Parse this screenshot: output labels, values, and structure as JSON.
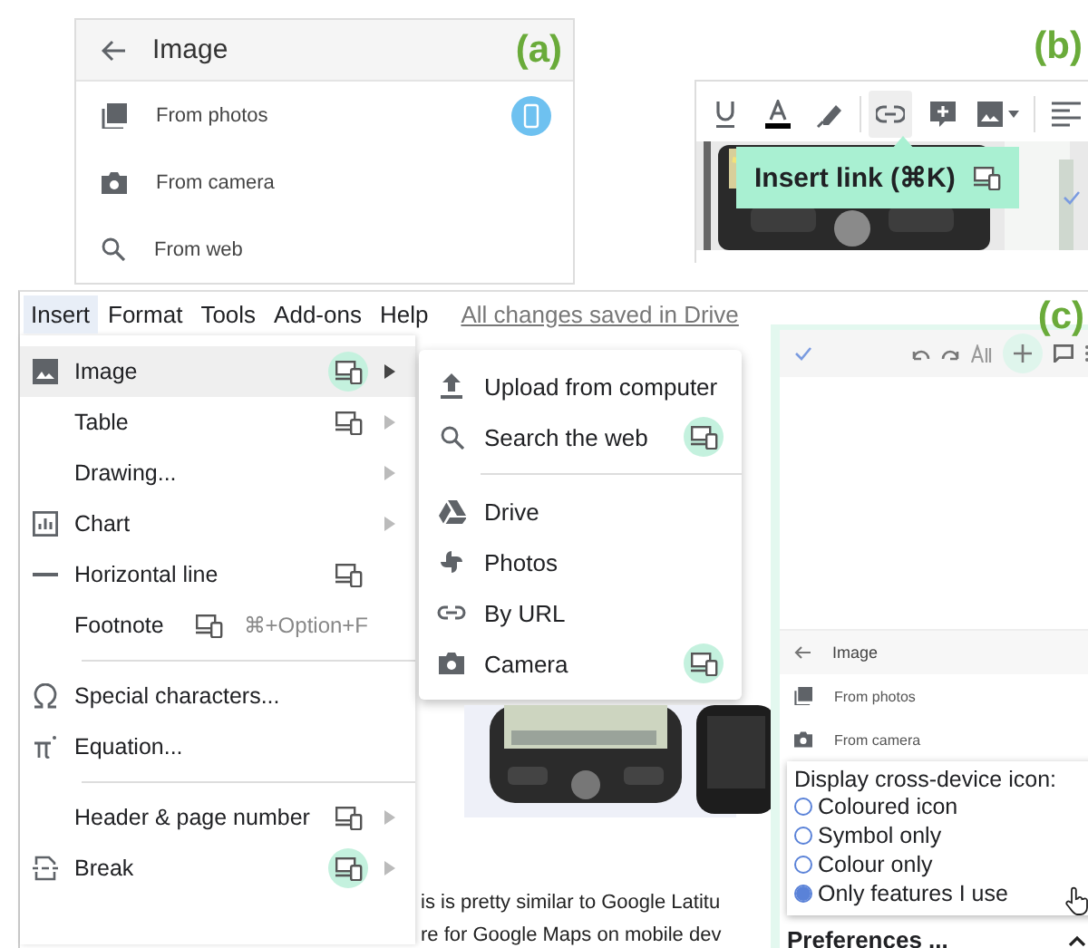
{
  "panel_a": {
    "label": "(a)",
    "title": "Image",
    "items": [
      {
        "label": "From photos",
        "device_badge": true
      },
      {
        "label": "From camera",
        "device_badge": false
      },
      {
        "label": "From web",
        "device_badge": false
      }
    ]
  },
  "panel_b": {
    "label": "(b)",
    "toolbar": [
      {
        "hovered": false
      },
      {
        "hovered": false
      },
      {
        "hovered": false
      },
      {
        "hovered": true
      },
      {
        "hovered": false
      },
      {
        "hovered": false
      },
      {
        "hovered": false
      }
    ],
    "tooltip": "Insert link (⌘K)"
  },
  "panel_c": {
    "label": "(c)",
    "menu_bar": [
      {
        "label": "Insert",
        "selected": true
      },
      {
        "label": "Format",
        "selected": false
      },
      {
        "label": "Tools",
        "selected": false
      },
      {
        "label": "Add-ons",
        "selected": false
      },
      {
        "label": "Help",
        "selected": false
      }
    ],
    "save_status": "All changes saved in Drive",
    "insert_menu": [
      [
        {
          "label": "Image",
          "selected": true,
          "device_icon": true,
          "badge_highlighted": true,
          "submenu": true
        },
        {
          "label": "Table",
          "selected": false,
          "device_icon": true,
          "badge_highlighted": false,
          "submenu": true
        },
        {
          "label": "Drawing...",
          "selected": false,
          "device_icon": false,
          "submenu": true
        },
        {
          "label": "Chart",
          "selected": false,
          "device_icon": false,
          "submenu": true
        },
        {
          "label": "Horizontal line",
          "selected": false,
          "device_icon": true,
          "badge_highlighted": false,
          "submenu": false
        },
        {
          "label": "Footnote",
          "selected": false,
          "device_icon": true,
          "badge_highlighted": false,
          "shortcut": "⌘+Option+F",
          "submenu": false
        }
      ],
      [
        {
          "label": "Special characters...",
          "selected": false,
          "device_icon": false,
          "submenu": false
        },
        {
          "label": "Equation...",
          "selected": false,
          "device_icon": false,
          "submenu": false
        }
      ],
      [
        {
          "label": "Header & page number",
          "selected": false,
          "device_icon": true,
          "badge_highlighted": false,
          "submenu": true
        },
        {
          "label": "Break",
          "selected": false,
          "device_icon": true,
          "badge_highlighted": true,
          "submenu": true
        }
      ]
    ],
    "image_submenu": [
      [
        {
          "label": "Upload from computer",
          "device_icon": false
        },
        {
          "label": "Search the web",
          "device_icon": true,
          "badge_highlighted": true
        }
      ],
      [
        {
          "label": "Drive",
          "device_icon": false
        },
        {
          "label": "Photos",
          "device_icon": false
        },
        {
          "label": "By URL",
          "device_icon": false
        },
        {
          "label": "Camera",
          "device_icon": true,
          "badge_highlighted": true
        }
      ]
    ],
    "document_text": [
      "is is pretty similar to Google Latitu",
      "re for Google Maps on mobile dev"
    ],
    "mobile": {
      "title": "Image",
      "items": [
        {
          "label": "From photos"
        },
        {
          "label": "From camera"
        }
      ],
      "preferences": {
        "prompt": "Display cross-device icon:",
        "options": [
          {
            "label": "Coloured icon",
            "selected": false
          },
          {
            "label": "Symbol only",
            "selected": false
          },
          {
            "label": "Colour only",
            "selected": false
          },
          {
            "label": "Only features I use",
            "selected": true
          }
        ],
        "footer": "Preferences ..."
      }
    }
  }
}
